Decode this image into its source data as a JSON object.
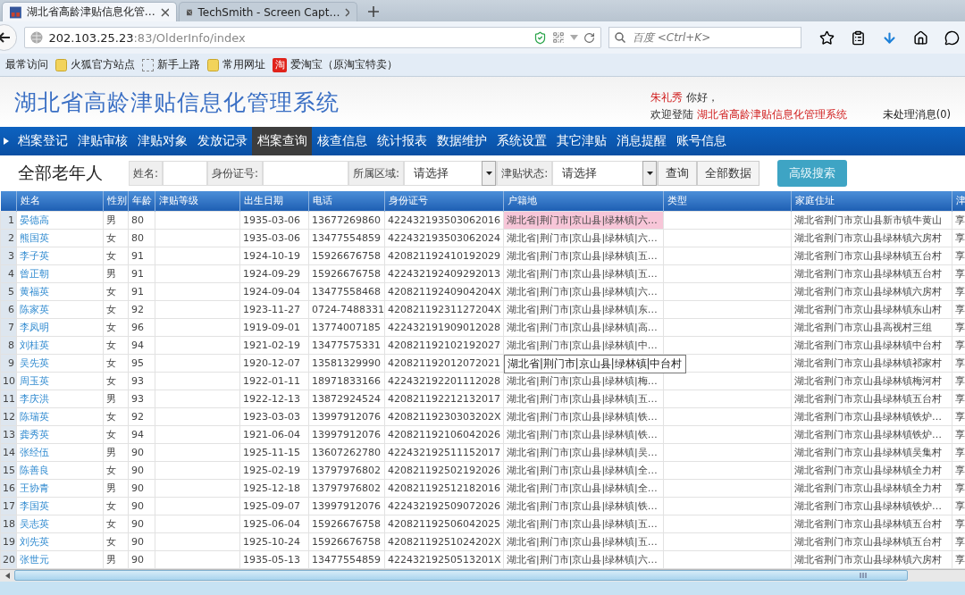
{
  "browser": {
    "tabs": [
      {
        "title": "湖北省高龄津贴信息化管…",
        "selected": true
      },
      {
        "title": "TechSmith - Screen Capt…",
        "selected": false
      }
    ],
    "url": {
      "host": "202.103.25.23",
      "path": ":83/OlderInfo/index"
    },
    "search_placeholder": "百度 <Ctrl+K>",
    "bookmarks": [
      {
        "kind": "plain",
        "label": "最常访问"
      },
      {
        "kind": "folder",
        "label": "火狐官方站点"
      },
      {
        "kind": "page",
        "label": "新手上路"
      },
      {
        "kind": "folder",
        "label": "常用网址"
      },
      {
        "kind": "badge",
        "badge": "淘",
        "label": "爱淘宝（原淘宝特卖）"
      }
    ]
  },
  "header": {
    "title": "湖北省高龄津贴信息化管理系统",
    "user": "朱礼秀",
    "greeting": "你好，",
    "welcome": "欢迎登陆",
    "system_name": "湖北省高龄津贴信息化管理系统",
    "messages": "未处理消息(0)"
  },
  "nav": [
    {
      "label": "档案登记",
      "selected": false
    },
    {
      "label": "津贴审核",
      "selected": false
    },
    {
      "label": "津贴对象",
      "selected": false
    },
    {
      "label": "发放记录",
      "selected": false
    },
    {
      "label": "档案查询",
      "selected": true
    },
    {
      "label": "核查信息",
      "selected": false
    },
    {
      "label": "统计报表",
      "selected": false
    },
    {
      "label": "数据维护",
      "selected": false
    },
    {
      "label": "系统设置",
      "selected": false
    },
    {
      "label": "其它津贴",
      "selected": false
    },
    {
      "label": "消息提醒",
      "selected": false
    },
    {
      "label": "账号信息",
      "selected": false
    }
  ],
  "search": {
    "heading": "全部老年人",
    "fields": [
      {
        "kind": "text",
        "label": "姓名:"
      },
      {
        "kind": "text",
        "label": "身份证号:"
      },
      {
        "kind": "select",
        "label": "所属区域:",
        "value": "请选择"
      },
      {
        "kind": "select",
        "label": "津贴状态:",
        "value": "请选择"
      }
    ],
    "buttons": [
      "查询",
      "全部数据"
    ],
    "advanced": "高级搜索"
  },
  "table": {
    "columns": [
      "姓名",
      "性别",
      "年龄",
      "津贴等级",
      "出生日期",
      "电话",
      "身份证号",
      "户籍地",
      "类型",
      "家庭住址",
      "津"
    ],
    "rows": [
      {
        "index": "1",
        "name": "晏德高",
        "gender": "男",
        "age": "80",
        "birth": "1935-03-06",
        "phone": "13677269860",
        "id": "422432193503062016",
        "household": "湖北省|荆门市|京山县|绿林镇|六…",
        "address": "湖北省荆门市京山县新市镇牛黄山",
        "column_11": "享",
        "selected": true
      },
      {
        "index": "2",
        "name": "熊国英",
        "gender": "女",
        "age": "80",
        "birth": "1935-03-06",
        "phone": "13477554859",
        "id": "422432193503062024",
        "household": "湖北省|荆门市|京山县|绿林镇|六…",
        "address": "湖北省荆门市京山县绿林镇六房村",
        "column_11": "享",
        "selected": false
      },
      {
        "index": "3",
        "name": "李子英",
        "gender": "女",
        "age": "91",
        "birth": "1924-10-19",
        "phone": "15926676758",
        "id": "420821192410192029",
        "household": "湖北省|荆门市|京山县|绿林镇|五…",
        "address": "湖北省荆门市京山县绿林镇五台村",
        "column_11": "享",
        "selected": false
      },
      {
        "index": "4",
        "name": "曾正朝",
        "gender": "男",
        "age": "91",
        "birth": "1924-09-29",
        "phone": "15926676758",
        "id": "422432192409292013",
        "household": "湖北省|荆门市|京山县|绿林镇|五…",
        "address": "湖北省荆门市京山县绿林镇五台村",
        "column_11": "享",
        "selected": false
      },
      {
        "index": "5",
        "name": "黄福英",
        "gender": "女",
        "age": "91",
        "birth": "1924-09-04",
        "phone": "13477558468",
        "id": "42082119240904204X",
        "household": "湖北省|荆门市|京山县|绿林镇|六…",
        "address": "湖北省荆门市京山县绿林镇六房村",
        "column_11": "享",
        "selected": false
      },
      {
        "index": "6",
        "name": "陈家英",
        "gender": "女",
        "age": "92",
        "birth": "1923-11-27",
        "phone": "0724-7488331",
        "id": "42082119231127204X",
        "household": "湖北省|荆门市|京山县|绿林镇|东…",
        "address": "湖北省荆门市京山县绿林镇东山村",
        "column_11": "享",
        "selected": false
      },
      {
        "index": "7",
        "name": "李凤明",
        "gender": "女",
        "age": "96",
        "birth": "1919-09-01",
        "phone": "13774007185",
        "id": "422432191909012028",
        "household": "湖北省|荆门市|京山县|绿林镇|高…",
        "address": "湖北省荆门市京山县高视村三组",
        "column_11": "享",
        "selected": false
      },
      {
        "index": "8",
        "name": "刘桂英",
        "gender": "女",
        "age": "94",
        "birth": "1921-02-19",
        "phone": "13477575331",
        "id": "420821192102192027",
        "household": "湖北省|荆门市|京山县|绿林镇|中…",
        "address": "湖北省荆门市京山县绿林镇中台村",
        "column_11": "享",
        "selected": false
      },
      {
        "index": "9",
        "name": "吴先英",
        "gender": "女",
        "age": "95",
        "birth": "1920-12-07",
        "phone": "13581329990",
        "id": "420821192012072021",
        "tooltip": "湖北省|荆门市|京山县|绿林镇|中台村",
        "address": "湖北省荆门市京山县绿林镇祁家村",
        "column_11": "享",
        "selected": false
      },
      {
        "index": "10",
        "name": "周玉英",
        "gender": "女",
        "age": "93",
        "birth": "1922-01-11",
        "phone": "18971833166",
        "id": "422432192201112028",
        "household": "湖北省|荆门市|京山县|绿林镇|梅…",
        "address": "湖北省荆门市京山县绿林镇梅河村",
        "column_11": "享",
        "selected": false
      },
      {
        "index": "11",
        "name": "李庆洪",
        "gender": "男",
        "age": "93",
        "birth": "1922-12-13",
        "phone": "13872924524",
        "id": "420821192212132017",
        "household": "湖北省|荆门市|京山县|绿林镇|五…",
        "address": "湖北省荆门市京山县绿林镇五台村",
        "column_11": "享",
        "selected": false
      },
      {
        "index": "12",
        "name": "陈瑞英",
        "gender": "女",
        "age": "92",
        "birth": "1923-03-03",
        "phone": "13997912076",
        "id": "42082119230303202X",
        "household": "湖北省|荆门市|京山县|绿林镇|铁…",
        "address": "湖北省荆门市京山县绿林镇铁炉…",
        "column_11": "享",
        "selected": false
      },
      {
        "index": "13",
        "name": "龚秀英",
        "gender": "女",
        "age": "94",
        "birth": "1921-06-04",
        "phone": "13997912076",
        "id": "420821192106042026",
        "household": "湖北省|荆门市|京山县|绿林镇|铁…",
        "address": "湖北省荆门市京山县绿林镇铁炉…",
        "column_11": "享",
        "selected": false
      },
      {
        "index": "14",
        "name": "张经伍",
        "gender": "男",
        "age": "90",
        "birth": "1925-11-15",
        "phone": "13607262780",
        "id": "422432192511152017",
        "household": "湖北省|荆门市|京山县|绿林镇|吴…",
        "address": "湖北省荆门市京山县绿林镇吴集村",
        "column_11": "享",
        "selected": false
      },
      {
        "index": "15",
        "name": "陈善良",
        "gender": "女",
        "age": "90",
        "birth": "1925-02-19",
        "phone": "13797976802",
        "id": "420821192502192026",
        "household": "湖北省|荆门市|京山县|绿林镇|全…",
        "address": "湖北省荆门市京山县绿林镇全力村",
        "column_11": "享",
        "selected": false
      },
      {
        "index": "16",
        "name": "王协青",
        "gender": "男",
        "age": "90",
        "birth": "1925-12-18",
        "phone": "13797976802",
        "id": "420821192512182016",
        "household": "湖北省|荆门市|京山县|绿林镇|全…",
        "address": "湖北省荆门市京山县绿林镇全力村",
        "column_11": "享",
        "selected": false
      },
      {
        "index": "17",
        "name": "李国英",
        "gender": "女",
        "age": "90",
        "birth": "1925-09-07",
        "phone": "13997912076",
        "id": "422432192509072026",
        "household": "湖北省|荆门市|京山县|绿林镇|铁…",
        "address": "湖北省荆门市京山县绿林镇铁炉…",
        "column_11": "享",
        "selected": false
      },
      {
        "index": "18",
        "name": "吴志英",
        "gender": "女",
        "age": "90",
        "birth": "1925-06-04",
        "phone": "15926676758",
        "id": "420821192506042025",
        "household": "湖北省|荆门市|京山县|绿林镇|五…",
        "address": "湖北省荆门市京山县绿林镇五台村",
        "column_11": "享",
        "selected": false
      },
      {
        "index": "19",
        "name": "刘先英",
        "gender": "女",
        "age": "90",
        "birth": "1925-10-24",
        "phone": "15926676758",
        "id": "42082119251024202X",
        "household": "湖北省|荆门市|京山县|绿林镇|五…",
        "address": "湖北省荆门市京山县绿林镇五台村",
        "column_11": "享",
        "selected": false
      },
      {
        "index": "20",
        "name": "张世元",
        "gender": "男",
        "age": "90",
        "birth": "1935-05-13",
        "phone": "13477554859",
        "id": "42243219250513201X",
        "household": "湖北省|荆门市|京山县|绿林镇|六…",
        "address": "湖北省荆门市京山县绿林镇六房村",
        "column_11": "享",
        "selected": false
      }
    ]
  }
}
